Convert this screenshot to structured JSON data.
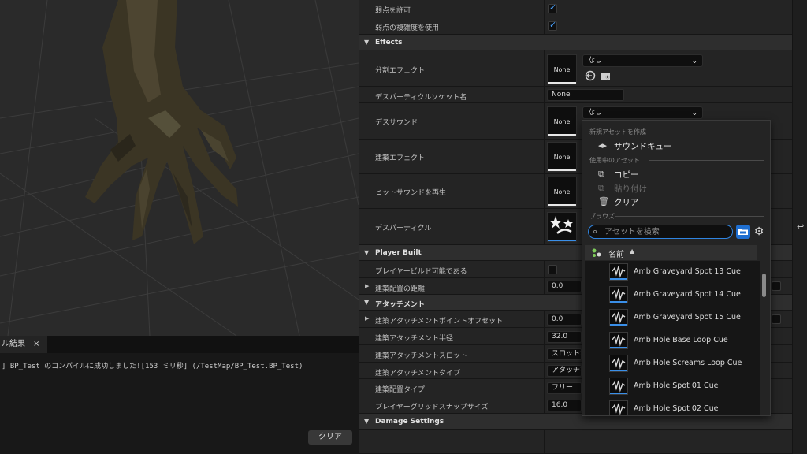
{
  "log": {
    "tab_label": "ル結果",
    "tab_close": "×",
    "message": "] BP_Test のコンパイルに成功しました![153 ミリ秒] (/TestMap/BP_Test.BP_Test)",
    "clear_button": "クリア"
  },
  "details": {
    "rows": {
      "allow_weak_point": "弱点を許可",
      "use_weak_point_complexity": "弱点の複雑度を使用",
      "break_effect": "分割エフェクト",
      "death_particle_socket": "デスパーティクルソケット名",
      "death_particle_socket_value": "None",
      "death_sound": "デスサウンド",
      "build_effect": "建築エフェクト",
      "play_hit_sound": "ヒットサウンドを再生",
      "death_particle": "デスパーティクル",
      "player_buildable": "プレイヤービルド可能である",
      "build_place_distance": "建築配置の距離",
      "build_place_distance_value": "0.0",
      "build_attach_offset": "建築アタッチメントポイントオフセット",
      "build_attach_offset_value": "0.0",
      "build_attach_radius": "建築アタッチメント半径",
      "build_attach_radius_value": "32.0",
      "build_attach_slot": "建築アタッチメントスロット",
      "build_attach_slot_value": "スロットな",
      "build_attach_type": "建築アタッチメントタイプ",
      "build_attach_type_value": "アタッチな",
      "build_place_type": "建築配置タイプ",
      "build_place_type_value": "フリー",
      "player_grid_snap_size": "プレイヤーグリッドスナップサイズ",
      "player_grid_snap_size_value": "16.0"
    },
    "categories": {
      "effects": "Effects",
      "player_built": "Player Built",
      "attachment": "アタッチメント",
      "damage_settings": "Damage Settings"
    },
    "thumb_none": "None",
    "combo_none": "なし"
  },
  "picker": {
    "section_create": "新規アセットを作成",
    "sound_cue": "サウンドキュー",
    "section_current": "使用中のアセット",
    "copy": "コピー",
    "paste": "貼り付け",
    "clear": "クリア",
    "section_browse": "ブラウズ",
    "search_placeholder": "アセットを検索",
    "name_header": "名前",
    "assets": [
      "Amb Graveyard Spot 13 Cue",
      "Amb Graveyard Spot 14 Cue",
      "Amb Graveyard Spot 15 Cue",
      "Amb Hole Base Loop Cue",
      "Amb Hole Screams Loop Cue",
      "Amb Hole Spot 01 Cue",
      "Amb Hole Spot 02 Cue"
    ]
  },
  "colors": {
    "accent": "#2f84e0",
    "checkbox": "#4aa3ff"
  }
}
